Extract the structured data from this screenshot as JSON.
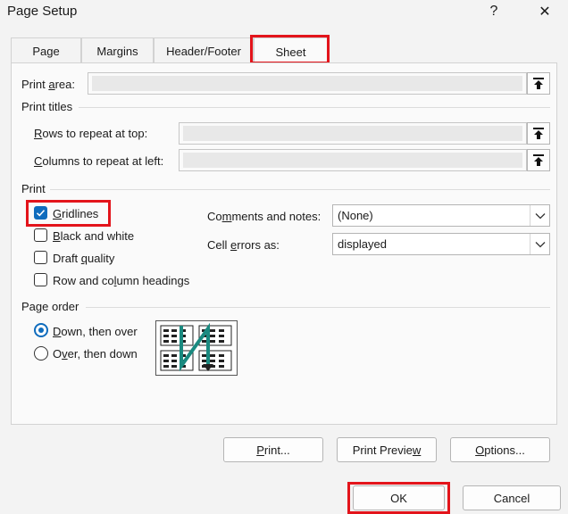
{
  "window": {
    "title": "Page Setup",
    "help_label": "?",
    "close_label": "✕"
  },
  "tabs": [
    "Page",
    "Margins",
    "Header/Footer",
    "Sheet"
  ],
  "active_tab": "Sheet",
  "print_area": {
    "label_pre": "Print ",
    "label_u": "a",
    "label_post": "rea:",
    "value": ""
  },
  "print_titles": {
    "heading": "Print titles",
    "rows": {
      "label_pre": "",
      "label_u": "R",
      "label_post": "ows to repeat at top:",
      "value": ""
    },
    "columns": {
      "label_pre": "",
      "label_u": "C",
      "label_post": "olumns to repeat at left:",
      "value": ""
    }
  },
  "print": {
    "heading": "Print",
    "gridlines": {
      "label_pre": "",
      "label_u": "G",
      "label_post": "ridlines",
      "checked": true
    },
    "black_white": {
      "label_pre": "",
      "label_u": "B",
      "label_post": "lack and white",
      "checked": false
    },
    "draft": {
      "label_pre": "Draft ",
      "label_u": "q",
      "label_post": "uality",
      "checked": false
    },
    "row_col_headings": {
      "label_pre": "Row and co",
      "label_u": "l",
      "label_post": "umn headings",
      "checked": false
    },
    "comments": {
      "label_pre": "Co",
      "label_u": "m",
      "label_post": "ments and notes:",
      "value": "(None)"
    },
    "cell_errors": {
      "label_pre": "Cell ",
      "label_u": "e",
      "label_post": "rrors as:",
      "value": "displayed"
    }
  },
  "page_order": {
    "heading": "Page order",
    "down_over": {
      "label_pre": "",
      "label_u": "D",
      "label_post": "own, then over",
      "selected": true
    },
    "over_down": {
      "label_pre": "O",
      "label_u": "v",
      "label_post": "er, then down",
      "selected": false
    }
  },
  "buttons": {
    "print": {
      "pre": "",
      "u": "P",
      "post": "rint..."
    },
    "print_preview": {
      "pre": "Print Previe",
      "u": "w",
      "post": ""
    },
    "options": {
      "pre": "",
      "u": "O",
      "post": "ptions..."
    },
    "ok": "OK",
    "cancel": "Cancel"
  },
  "colors": {
    "highlight": "#e3141b",
    "accent": "#0f6cbd",
    "arrow": "#1a8a80"
  }
}
